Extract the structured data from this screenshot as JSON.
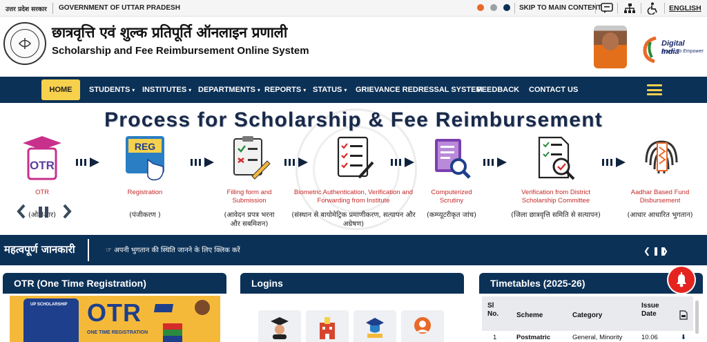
{
  "topbar": {
    "state_hindi": "उत्तर प्रदेश सरकार",
    "govt": "GOVERNMENT OF UTTAR PRADESH",
    "theme_colors": [
      "#e8692a",
      "#9aa0a6",
      "#0c3157"
    ],
    "skip": "SKIP TO MAIN CONTENT",
    "language": "ENGLISH"
  },
  "header": {
    "title_hindi": "छात्रवृत्ति एवं शुल्क प्रतिपूर्ति ऑनलाइन प्रणाली",
    "title_english": "Scholarship and Fee Reimbursement Online System",
    "digital_india": "Digital India",
    "digital_india_tag": "Power To Empower"
  },
  "nav": {
    "items": [
      {
        "label": "HOME",
        "caret": false
      },
      {
        "label": "STUDENTS",
        "caret": true
      },
      {
        "label": "INSTITUTES",
        "caret": true
      },
      {
        "label": "DEPARTMENTS",
        "caret": true
      },
      {
        "label": "REPORTS",
        "caret": true
      },
      {
        "label": "STATUS",
        "caret": true
      },
      {
        "label": "GRIEVANCE REDRESSAL SYSTEM",
        "caret": false
      },
      {
        "label": "FEEDBACK",
        "caret": false
      },
      {
        "label": "CONTACT US",
        "caret": false
      }
    ]
  },
  "process": {
    "title": "Process for Scholarship & Fee Reimbursement",
    "steps": [
      {
        "en": "OTR",
        "hi": "(ओटीआर)"
      },
      {
        "en": "Registration",
        "hi": "(पंजीकरण )"
      },
      {
        "en": "Filling form and Submission",
        "hi": "(आवेदन प्रपत्र भरना और सबमिशन)"
      },
      {
        "en": "Biometric Authentication, Verification and Forwarding from Institute",
        "hi": "(संस्थान से बायोमेट्रिक प्रमाणीकरण, सत्यापन और अग्रेषण)"
      },
      {
        "en": "Computerized Scrutiny",
        "hi": "(कम्प्यूटरीकृत जांच)"
      },
      {
        "en": "Verification from District Scholarship Committee",
        "hi": "(जिला छात्रवृत्ति समिति से सत्यापन)"
      },
      {
        "en": "Aadhar Based Fund Disbursement",
        "hi": "(आधार आधारित भुगतान)"
      }
    ],
    "reg_icon_text": "REG"
  },
  "info": {
    "label": "महत्वपूर्ण जानकारी",
    "ticker": "अपनी भुगतान की स्थिति जानने के लिए क्लिक करें"
  },
  "cards": {
    "otr": {
      "title": "OTR (One Time Registration)",
      "banner_phone": "UP SCHOLARSHIP",
      "banner_big": "OTR",
      "banner_sub": "ONE TIME REGISTRATION"
    },
    "logins": {
      "title": "Logins"
    },
    "timetables": {
      "title": "Timetables (2025-26)",
      "headers": {
        "sl": "Sl No.",
        "scheme": "Scheme",
        "category": "Category",
        "issue": "Issue Date"
      },
      "row1": {
        "sl": "1",
        "scheme": "Postmatric",
        "category": "General, Minority",
        "issue": "10.06"
      }
    }
  }
}
